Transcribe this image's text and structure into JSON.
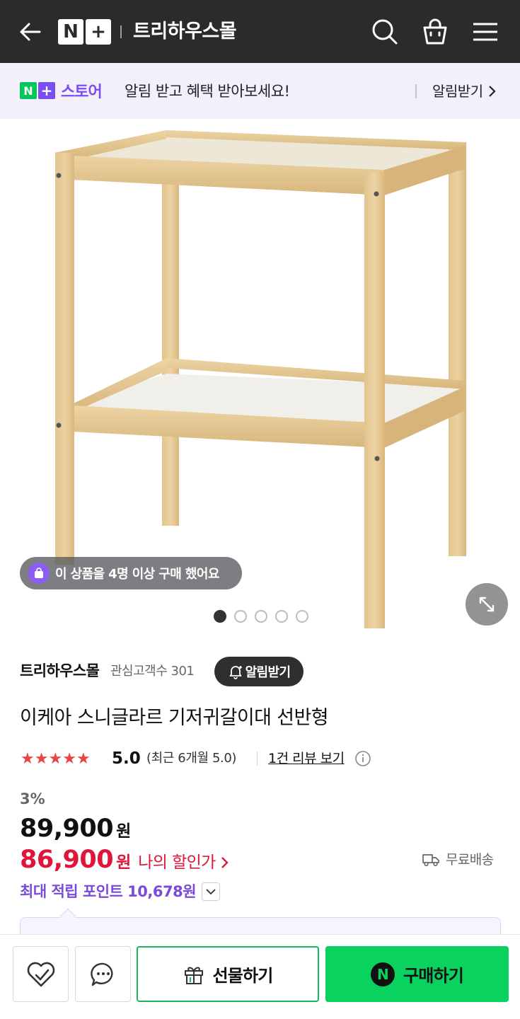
{
  "header": {
    "logo_text": "N+",
    "title": "트리하우스몰",
    "icons": [
      "back-arrow-icon",
      "search-icon",
      "shopping-bag-icon",
      "menu-icon"
    ]
  },
  "banner": {
    "logo_label": "스토어",
    "text": "알림 받고 혜택 받아보세요!",
    "cta_label": "알림받기"
  },
  "gallery": {
    "buyer_badge": "이 상품을 4명 이상 구매 했어요",
    "total_images": 5,
    "active_index": 0
  },
  "seller": {
    "name": "트리하우스몰",
    "followers": "관심고객수 301",
    "notify_label": "알림받기"
  },
  "product": {
    "title": "이케아 스니글라르 기저귀갈이대 선반형"
  },
  "rating": {
    "stars": 5,
    "score": "5.0",
    "recent": "(최근 6개월 5.0)",
    "review_link": "1건 리뷰 보기"
  },
  "price": {
    "discount": "3%",
    "original": "89,900",
    "original_unit": "원",
    "sale": "86,900",
    "sale_unit": "원",
    "my_discount_label": "나의 할인가",
    "shipping": "무료배송",
    "points": "최대 적립 포인트 10,678원"
  },
  "bottom": {
    "gift_label": "선물하기",
    "buy_label": "구매하기",
    "buy_badge": "N"
  },
  "colors": {
    "header_bg": "#2b2b2b",
    "banner_bg": "#f3f0fb",
    "accent_purple": "#7b4cf2",
    "sale_red": "#e0153a",
    "star_red": "#e84545",
    "naver_green": "#09d35e"
  }
}
